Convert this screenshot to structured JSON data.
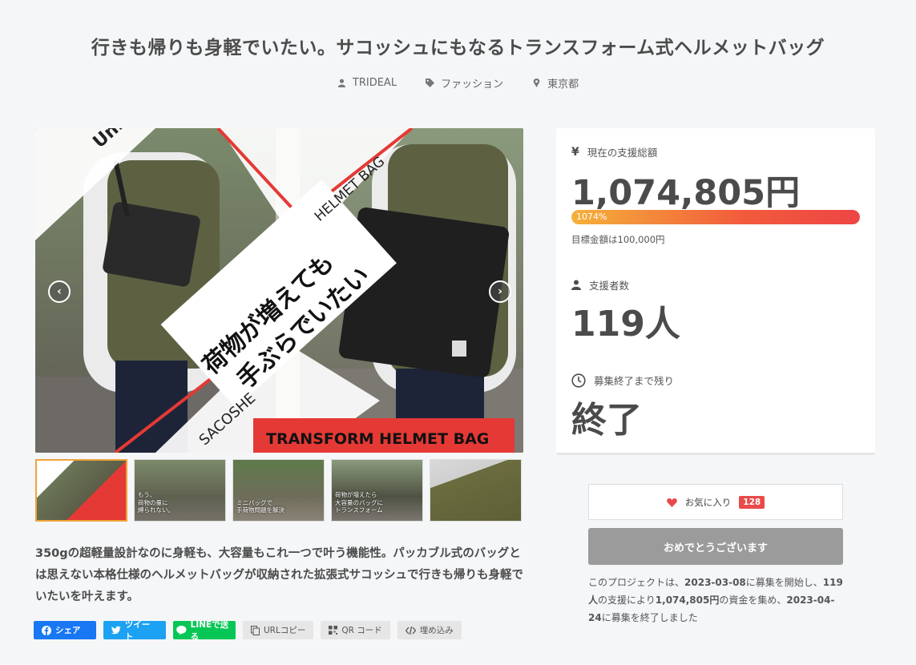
{
  "project": {
    "title": "行きも帰りも身軽でいたい。サコッシュにもなるトランスフォーム式ヘルメットバッグ",
    "owner": "TRIDEAL",
    "category": "ファッション",
    "location": "東京都"
  },
  "hero": {
    "brand_text": "UniRT",
    "helmet_text": "HELMET BAG",
    "catch_line1": "荷物が増えても",
    "catch_line2": "手ぶらでいたい",
    "sacoshe_text": "SACOSHE",
    "banner_text": "TRANSFORM HELMET BAG",
    "prev_arrow": "‹",
    "next_arrow": "›"
  },
  "thumbnails": [
    {
      "caption": ""
    },
    {
      "caption": "もう、\n荷物の量に\n縛られない。"
    },
    {
      "caption": "ミニバッグで\n手荷物問題を解決"
    },
    {
      "caption": "荷物が増えたら\n大容量のバッグに\nトランスフォーム"
    },
    {
      "caption": ""
    }
  ],
  "description": "350gの超軽量設計なのに身軽も、大容量もこれ一つで叶う機能性。パッカブル式のバッグとは思えない本格仕様のヘルメットバッグが収納された拡張式サコッシュで行きも帰りも身軽でいたいを叶えます。",
  "share": {
    "facebook": "シェア",
    "twitter": "ツイート",
    "line": "LINEで送る",
    "url_copy": "URLコピー",
    "qr": "QR コード",
    "embed": "埋め込み"
  },
  "stats": {
    "total_label": "現在の支援総額",
    "total_value": "1,074,805円",
    "progress_percent_label": "1074%",
    "progress_fraction": 1.0,
    "goal_text": "目標金額は100,000円",
    "backers_label": "支援者数",
    "backers_value": "119人",
    "remaining_label": "募集終了まで残り",
    "remaining_value": "終了"
  },
  "actions": {
    "favorite_label": "お気に入り",
    "favorite_count": "128",
    "congrats_label": "おめでとうございます"
  },
  "summary": {
    "p1": "このプロジェクトは、",
    "start_date": "2023-03-08",
    "p2": "に募集を開始し、",
    "backers": "119人",
    "p3": "の支援により",
    "amount": "1,074,805円",
    "p4": "の資金を集め、",
    "end_date": "2023-04-24",
    "p5": "に募集を終了しました"
  },
  "colors": {
    "accent_red": "#e94a4a",
    "facebook": "#1877f2",
    "twitter": "#1da1f2",
    "line": "#06c755"
  }
}
